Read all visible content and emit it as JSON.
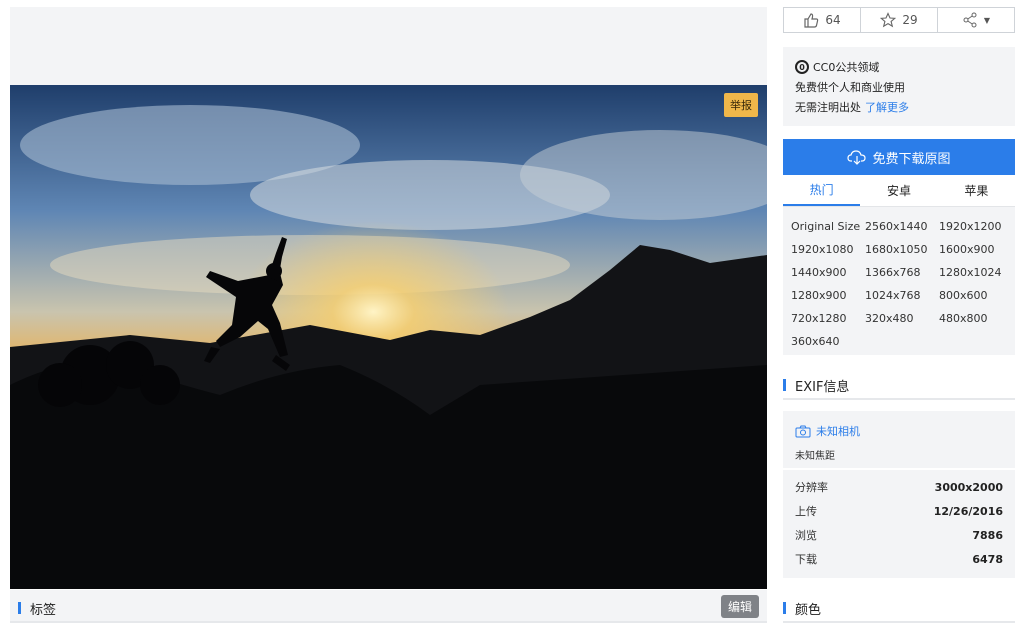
{
  "image": {
    "report_label": "举报"
  },
  "tags": {
    "title": "标签",
    "edit_label": "编辑"
  },
  "actions": {
    "likes": "64",
    "favorites": "29"
  },
  "license": {
    "title": "CC0公共领域",
    "line1": "免费供个人和商业使用",
    "line2": "无需注明出处",
    "link": "了解更多"
  },
  "download": {
    "button_label": "免费下载原图",
    "tabs": [
      "热门",
      "安卓",
      "苹果"
    ],
    "sizes": [
      "Original Size",
      "2560x1440",
      "1920x1200",
      "1920x1080",
      "1680x1050",
      "1600x900",
      "1440x900",
      "1366x768",
      "1280x1024",
      "1280x900",
      "1024x768",
      "800x600",
      "720x1280",
      "320x480",
      "480x800",
      "360x640"
    ]
  },
  "exif": {
    "title": "EXIF信息",
    "camera": "未知相机",
    "focal": "未知焦距",
    "stats": [
      {
        "label": "分辨率",
        "value": "3000x2000"
      },
      {
        "label": "上传",
        "value": "12/26/2016"
      },
      {
        "label": "浏览",
        "value": "7886"
      },
      {
        "label": "下载",
        "value": "6478"
      }
    ]
  },
  "color": {
    "title": "颜色"
  },
  "colors": {
    "accent": "#2b7de9",
    "report": "#f0b74a",
    "panel": "#f3f4f6"
  }
}
